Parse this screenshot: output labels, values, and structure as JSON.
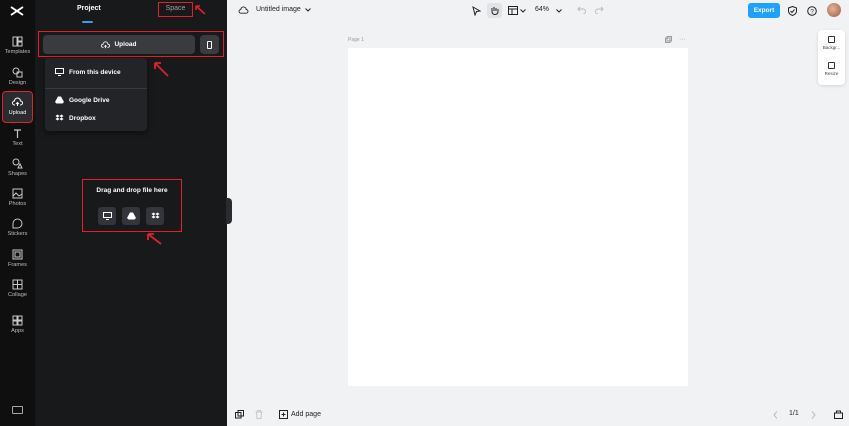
{
  "rail": {
    "items": [
      {
        "label": "Templates",
        "icon": "templates-icon"
      },
      {
        "label": "Design",
        "icon": "design-icon"
      },
      {
        "label": "Upload",
        "icon": "upload-cloud-icon",
        "active": true
      },
      {
        "label": "Text",
        "icon": "text-icon"
      },
      {
        "label": "Shapes",
        "icon": "shapes-icon"
      },
      {
        "label": "Photos",
        "icon": "photos-icon"
      },
      {
        "label": "Stickers",
        "icon": "stickers-icon"
      },
      {
        "label": "Frames",
        "icon": "frames-icon"
      },
      {
        "label": "Collage",
        "icon": "collage-icon"
      },
      {
        "label": "Apps",
        "icon": "apps-icon"
      }
    ]
  },
  "panel": {
    "tabs": {
      "project": "Project",
      "space": "Space"
    },
    "upload_label": "Upload",
    "menu": {
      "from_device": "From this device",
      "google_drive": "Google Drive",
      "dropbox": "Dropbox"
    },
    "drop_text": "Drag and drop file here"
  },
  "topbar": {
    "title": "Untitled image",
    "zoom": "64%",
    "export_label": "Export"
  },
  "canvas": {
    "page_label": "Page 1"
  },
  "side_tools": {
    "background": "Backgr...",
    "resize": "Resize"
  },
  "bottombar": {
    "add_page": "Add page",
    "page_count": "1/1"
  },
  "colors": {
    "accent": "#1fa1ff",
    "highlight": "#e2202a",
    "panel_bg": "#18191b"
  }
}
